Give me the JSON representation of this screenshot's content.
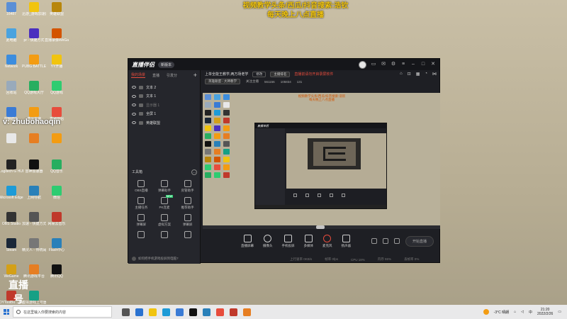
{
  "overlay": {
    "line1": "视频教学头条/西瓜/抖音搜索:浩钦",
    "line2": "每天晚上八点直播"
  },
  "watermark": {
    "wechat": "v: zhubohaoqin",
    "room_title": "直播号",
    "room_number": "561156"
  },
  "desktop": {
    "col1": [
      {
        "label": "16487",
        "color": "#5b8fd6"
      },
      {
        "label": "此电脑",
        "color": "#4aa3df"
      },
      {
        "label": "Network",
        "color": "#3c8dde"
      },
      {
        "label": "回收站",
        "color": "#9ab"
      },
      {
        "label": "控制面板",
        "color": "#3a7bd5"
      },
      {
        "label": "",
        "color": "#e8e8e8"
      },
      {
        "label": "Logitech G HUB",
        "color": "#222"
      },
      {
        "label": "Microsoft Edge",
        "color": "#1d9bd7"
      },
      {
        "label": "OBS Studio",
        "color": "#333"
      },
      {
        "label": "Steam",
        "color": "#1b2838"
      },
      {
        "label": "WeGame",
        "color": "#d4a017"
      },
      {
        "label": "DYToolBo... 快捷方式",
        "color": "#c0392b"
      }
    ],
    "col2": [
      {
        "label": "迅游_游戏加速器",
        "color": "#f1c40f"
      },
      {
        "label": "pr - 快捷方式",
        "color": "#4a2fbf"
      },
      {
        "label": "PUBG BATTLEGR...",
        "color": "#f39c12"
      },
      {
        "label": "QQ游戏大厅",
        "color": "#27ae60"
      },
      {
        "label": "虎牙直播",
        "color": "#f39c12"
      },
      {
        "label": "",
        "color": "#e67e22"
      },
      {
        "label": "雷神加速器",
        "color": "#111"
      },
      {
        "label": "上网导航",
        "color": "#2980b9"
      },
      {
        "label": "加速 - 快捷方式",
        "color": "#555"
      },
      {
        "label": "精灵人 - 传统闹钟",
        "color": "#777"
      },
      {
        "label": "腾讯游戏平台",
        "color": "#e67e22"
      },
      {
        "label": "虚拟游戏上号器",
        "color": "#16a085"
      }
    ],
    "col3": [
      {
        "label": "英雄联盟",
        "color": "#b8860b"
      },
      {
        "label": "直播录像WeGame",
        "color": "#d35400"
      },
      {
        "label": "YY开播",
        "color": "#f1c40f"
      },
      {
        "label": "QQ游戏",
        "color": "#2ecc71"
      },
      {
        "label": "直播伴侣",
        "color": "#e74c3c"
      },
      {
        "label": "",
        "color": "#f39c12"
      },
      {
        "label": "QQ音乐",
        "color": "#27ae60"
      },
      {
        "label": "微信",
        "color": "#2ecc71"
      },
      {
        "label": "网易云音乐",
        "color": "#c0392b"
      },
      {
        "label": "Flash中心",
        "color": "#2980b9"
      },
      {
        "label": "腾讯QQ",
        "color": "#111"
      }
    ]
  },
  "app": {
    "logo": "直播伴侣",
    "version_badge": "新版本",
    "left_tabs": [
      "我的场景",
      "直播",
      "引发分"
    ],
    "sources": [
      {
        "label": "文本 2",
        "dim": false
      },
      {
        "label": "文本 1",
        "dim": false
      },
      {
        "label": "显示器 1",
        "dim": true
      },
      {
        "label": "全屏 1",
        "dim": false
      },
      {
        "label": "英雄联盟",
        "dim": false
      }
    ],
    "tools_title": "工具箱",
    "tools": [
      {
        "label": "OBS直播",
        "new": false
      },
      {
        "label": "弹幕助手",
        "new": false
      },
      {
        "label": "房管助手",
        "new": false
      },
      {
        "label": "主播任务",
        "new": false
      },
      {
        "label": "PK连麦",
        "new": true
      },
      {
        "label": "推荐助手",
        "new": false
      },
      {
        "label": "弹幕屏",
        "new": false
      },
      {
        "label": "虚拟方案",
        "new": false
      },
      {
        "label": "弹幕屏",
        "new": false
      },
      {
        "label": "",
        "new": false
      },
      {
        "label": "",
        "new": false
      },
      {
        "label": "",
        "new": false
      }
    ],
    "footer_note": "如何把手机游戏投屏到电脑?",
    "stream_title": "上单全能王教学,两万场老学",
    "modify_btn": "修改",
    "ranking_btn": "主播排名",
    "warning": "直播前请勿开启录屏软件",
    "category_pill": "英雄联盟 - 大神教学",
    "stats": [
      "关注主播",
      "561156",
      "105834",
      "131"
    ],
    "preview_overlay_1": "视频教学头条/西瓜/抖音搜索:浩钦",
    "preview_overlay_2": "每天晚上八点直播",
    "inner_logo": "直播伴侣",
    "bottom_buttons": [
      {
        "label": "直播屏幕",
        "icon": "screen-icon",
        "round": false,
        "mic": false
      },
      {
        "label": "摄像头",
        "icon": "camera-icon",
        "round": true,
        "mic": false
      },
      {
        "label": "手机投屏",
        "icon": "phone-cast-icon",
        "round": false,
        "mic": false
      },
      {
        "label": "多媒体",
        "icon": "media-icon",
        "round": false,
        "mic": false
      },
      {
        "label": "麦克风",
        "icon": "mic-icon",
        "round": true,
        "mic": true
      },
      {
        "label": "扬声器",
        "icon": "speaker-icon",
        "round": false,
        "mic": false
      }
    ],
    "start_button": "开始直播",
    "status": [
      "上行速率 0KB/s",
      "帧率 0fps",
      "CPU 18%",
      "内存 55%",
      "丢帧率 0%"
    ]
  },
  "taskbar": {
    "search_placeholder": "在这里输入你要搜索的内容",
    "weather": "-3°C 晴朗",
    "lang": "中",
    "time": "21:20",
    "date": "2022/2/26",
    "apps": [
      "#555",
      "#2a72d0",
      "#f1c40f",
      "#1d9bd7",
      "#3a7bd5",
      "#111",
      "#2980b9",
      "#e74c3c",
      "#c0392b",
      "#e67e22"
    ]
  }
}
